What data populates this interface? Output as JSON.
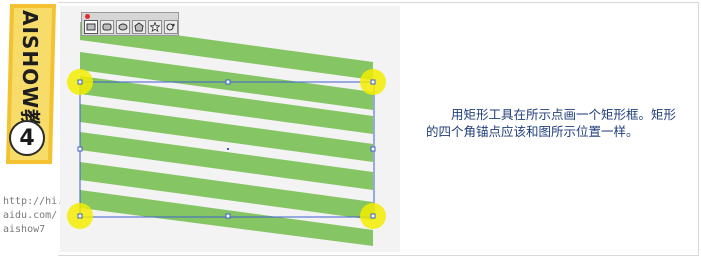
{
  "sidebar": {
    "title": "AISHOW教程",
    "step_number": "4",
    "url_text": "http://hi.b\naidu.com/\naishow7"
  },
  "toolbar": {
    "tools": [
      {
        "name": "rectangle-tool-icon",
        "active": true
      },
      {
        "name": "rounded-rectangle-tool-icon",
        "active": false
      },
      {
        "name": "ellipse-tool-icon",
        "active": false
      },
      {
        "name": "polygon-tool-icon",
        "active": false
      },
      {
        "name": "star-tool-icon",
        "active": false
      },
      {
        "name": "flare-tool-icon",
        "active": false
      }
    ]
  },
  "description": {
    "text": "用矩形工具在所示点画一个矩形框。矩形的四个角锚点应该和图所示位置一样。"
  },
  "colors": {
    "stripe": "#86c564",
    "selection": "#3e5fd1",
    "anchor_highlight": "#f2ec00",
    "description_text": "#1f3e7a",
    "banner": "#f2c230"
  }
}
